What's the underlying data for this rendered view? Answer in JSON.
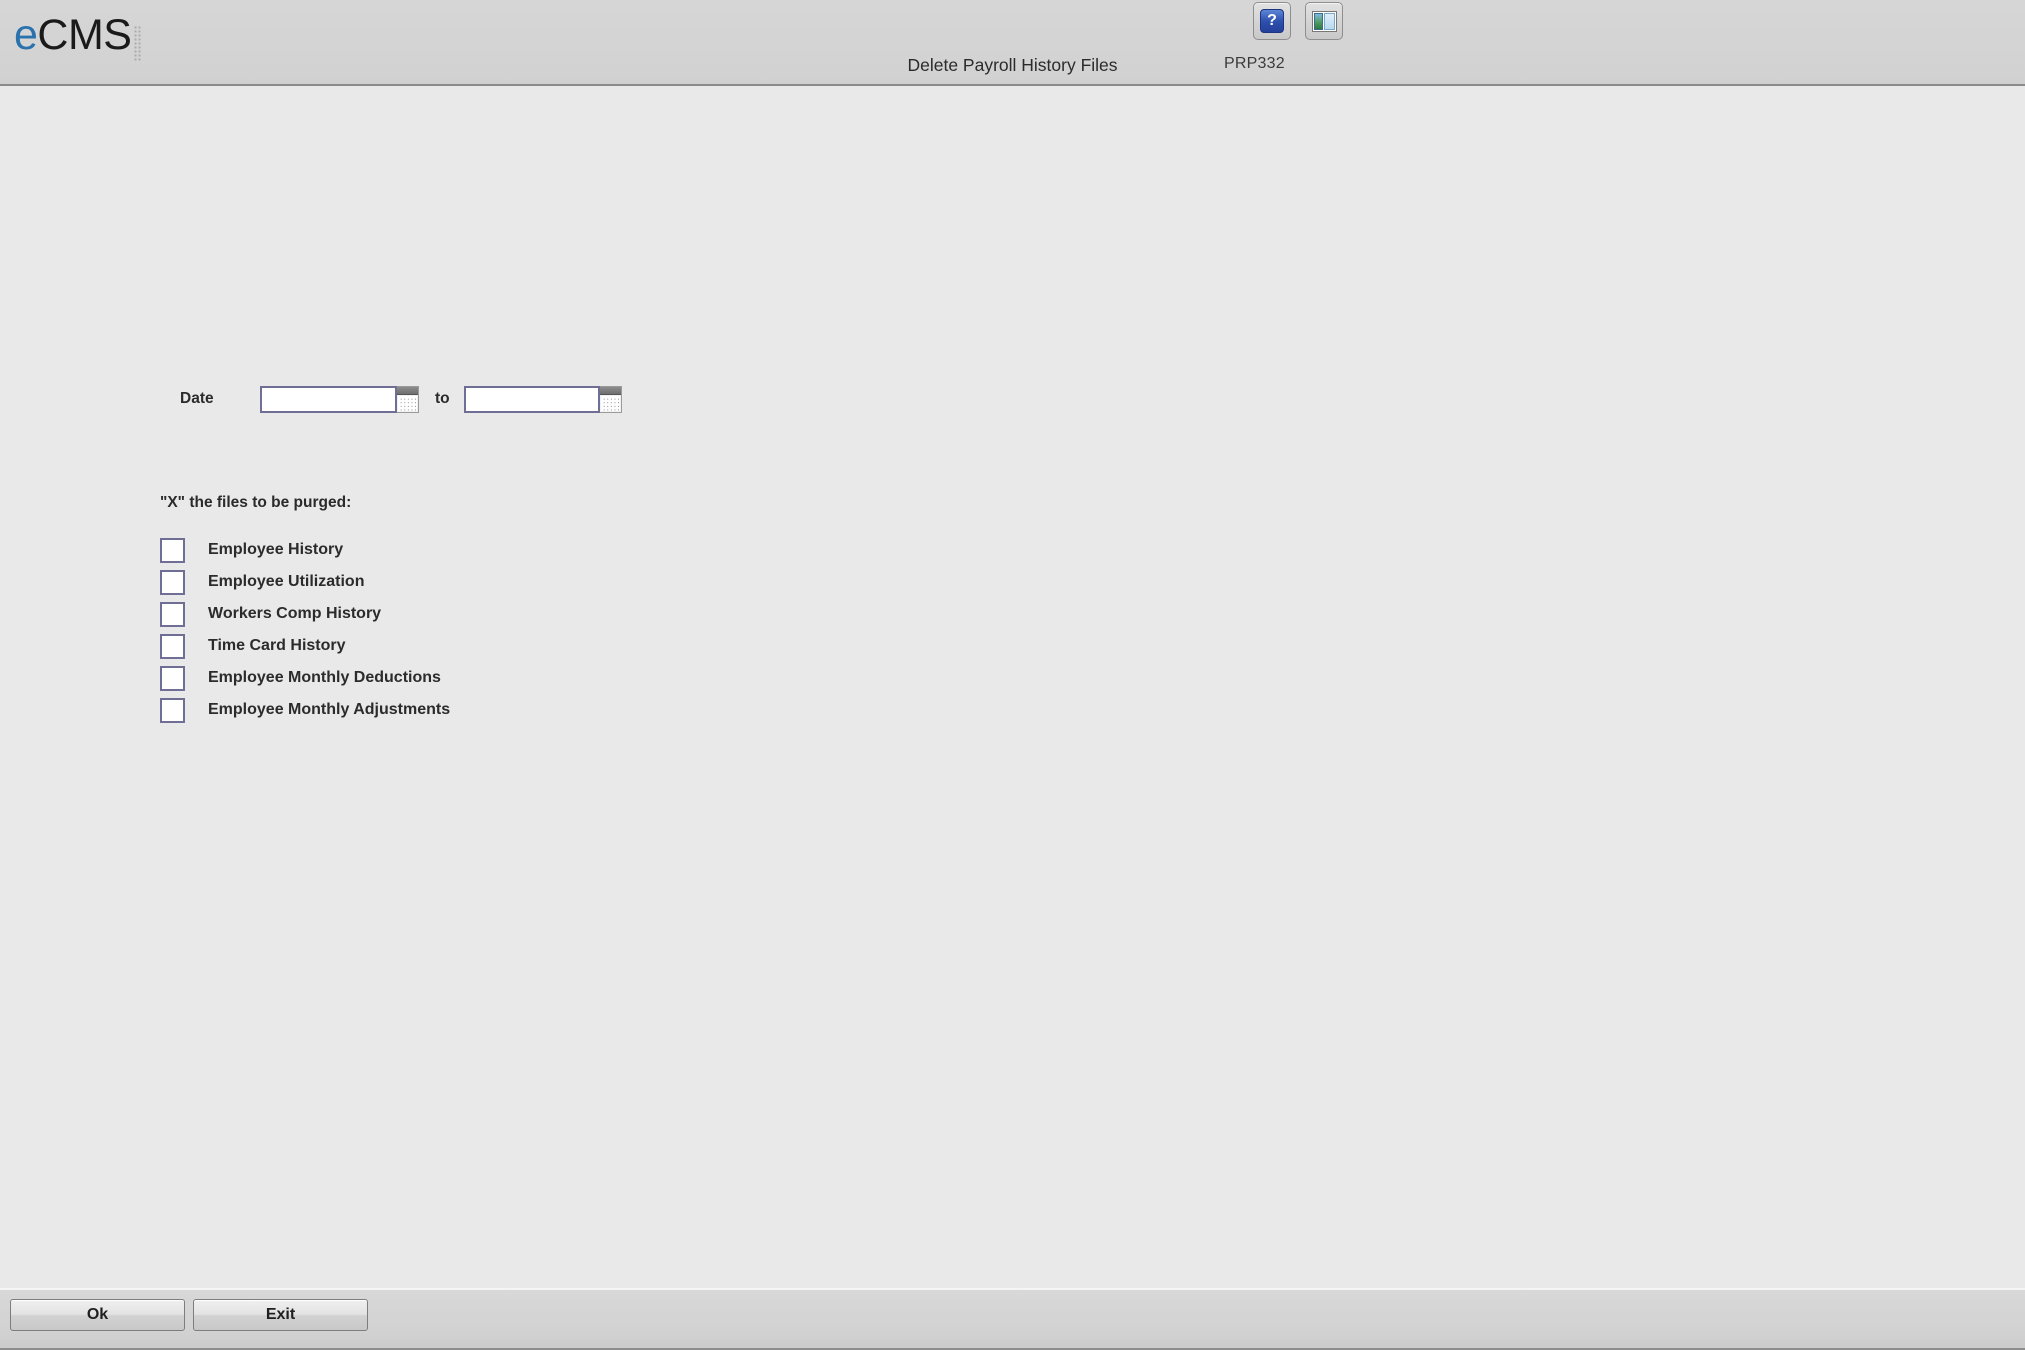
{
  "header": {
    "brand_e": "e",
    "brand_rest": "CMS",
    "title": "Delete Payroll History Files",
    "program_id": "PRP332",
    "tools": [
      {
        "name": "help-button",
        "icon": "help-icon",
        "glyph": "?"
      },
      {
        "name": "window-panel-button",
        "icon": "window-panel-icon"
      }
    ]
  },
  "form": {
    "date": {
      "label": "Date",
      "separator": "to",
      "from_value": "",
      "from_placeholder": "",
      "to_value": "",
      "to_placeholder": "",
      "calendar_icon": "calendar-icon"
    },
    "purge": {
      "heading": "\"X\" the files to be purged:",
      "items": [
        {
          "label": "Employee History",
          "checked": false
        },
        {
          "label": "Employee Utilization",
          "checked": false
        },
        {
          "label": "Workers Comp History",
          "checked": false
        },
        {
          "label": "Time Card History",
          "checked": false
        },
        {
          "label": "Employee Monthly Deductions",
          "checked": false
        },
        {
          "label": "Employee Monthly Adjustments",
          "checked": false
        }
      ]
    }
  },
  "footer": {
    "ok_label": "Ok",
    "exit_label": "Exit"
  },
  "colors": {
    "brand_blue": "#2a72ad",
    "header_bg": "#d2d2d2",
    "body_bg": "#e9e9e9",
    "footer_bg": "#d2d2d2",
    "field_border": "#6f6f96",
    "text": "#2b2b2b"
  }
}
